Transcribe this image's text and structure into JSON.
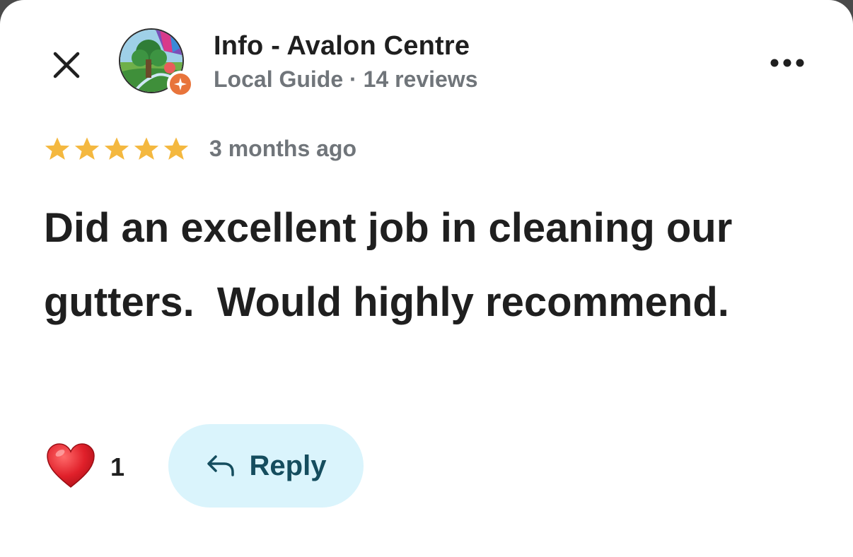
{
  "author": {
    "name": "Info - Avalon Centre",
    "meta": "Local Guide · 14 reviews"
  },
  "review": {
    "rating": 5,
    "max_rating": 5,
    "date": "3 months ago",
    "text": "Did an excellent job in cleaning our gutters.  Would highly recommend."
  },
  "actions": {
    "like_count": "1",
    "reply_label": "Reply"
  },
  "icons": {
    "close": "close-icon",
    "more": "more-options-icon",
    "like": "heart-icon",
    "reply": "reply-arrow-icon",
    "badge": "local-guide-star-icon"
  },
  "colors": {
    "star": "#f4b83f",
    "reply_bg": "#daf4fc",
    "reply_text": "#154d5e",
    "badge": "#e8743b",
    "heart": "#e0202a",
    "meta_text": "#70757a"
  }
}
